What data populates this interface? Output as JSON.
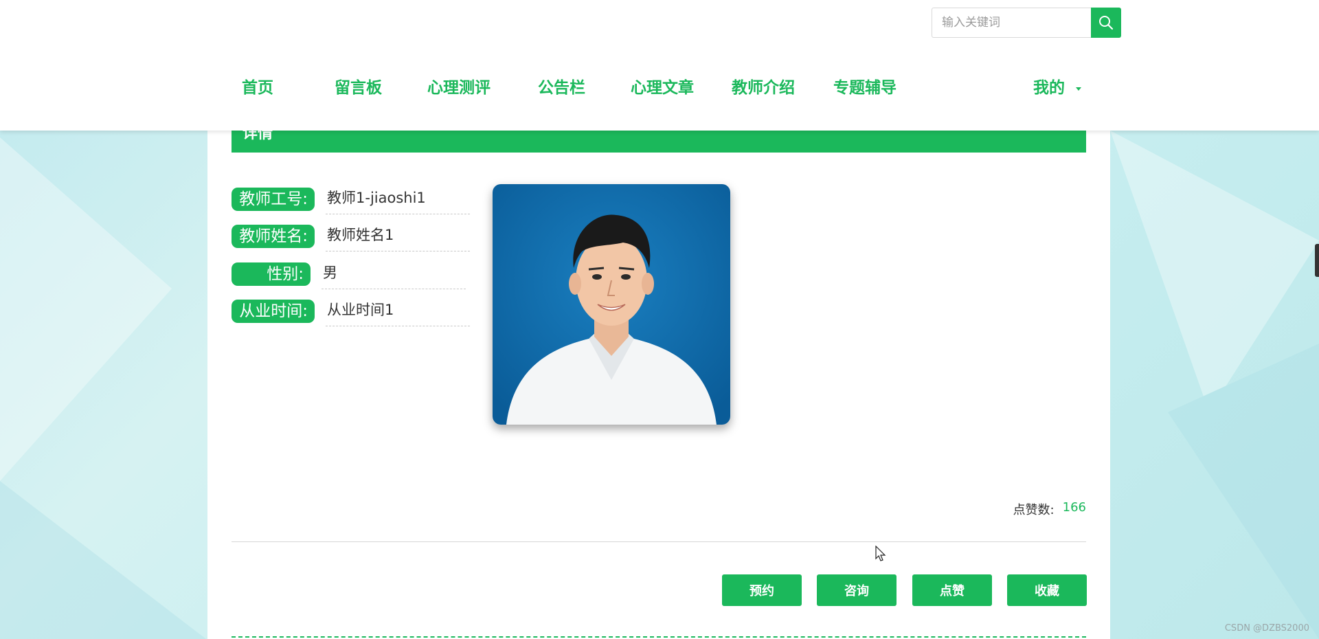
{
  "search": {
    "placeholder": "输入关键词"
  },
  "nav": {
    "items": [
      {
        "label": "首页"
      },
      {
        "label": "留言板"
      },
      {
        "label": "心理测评"
      },
      {
        "label": "公告栏"
      },
      {
        "label": "心理文章"
      },
      {
        "label": "教师介绍"
      },
      {
        "label": "专题辅导"
      }
    ],
    "mine_label": "我的"
  },
  "detail": {
    "header": "详情",
    "fields": [
      {
        "label": "教师工号:",
        "value": "教师1-jiaoshi1"
      },
      {
        "label": "教师姓名:",
        "value": "教师姓名1"
      },
      {
        "label": "性别:",
        "value": "男"
      },
      {
        "label": "从业时间:",
        "value": "从业时间1"
      }
    ],
    "likes_label": "点赞数:",
    "likes_count": "166"
  },
  "actions": {
    "reserve": "预约",
    "consult": "咨询",
    "like": "点赞",
    "favorite": "收藏"
  },
  "watermark": "CSDN @DZBS2000",
  "colors": {
    "accent": "#1bb85b",
    "background": "#c7eef0"
  }
}
